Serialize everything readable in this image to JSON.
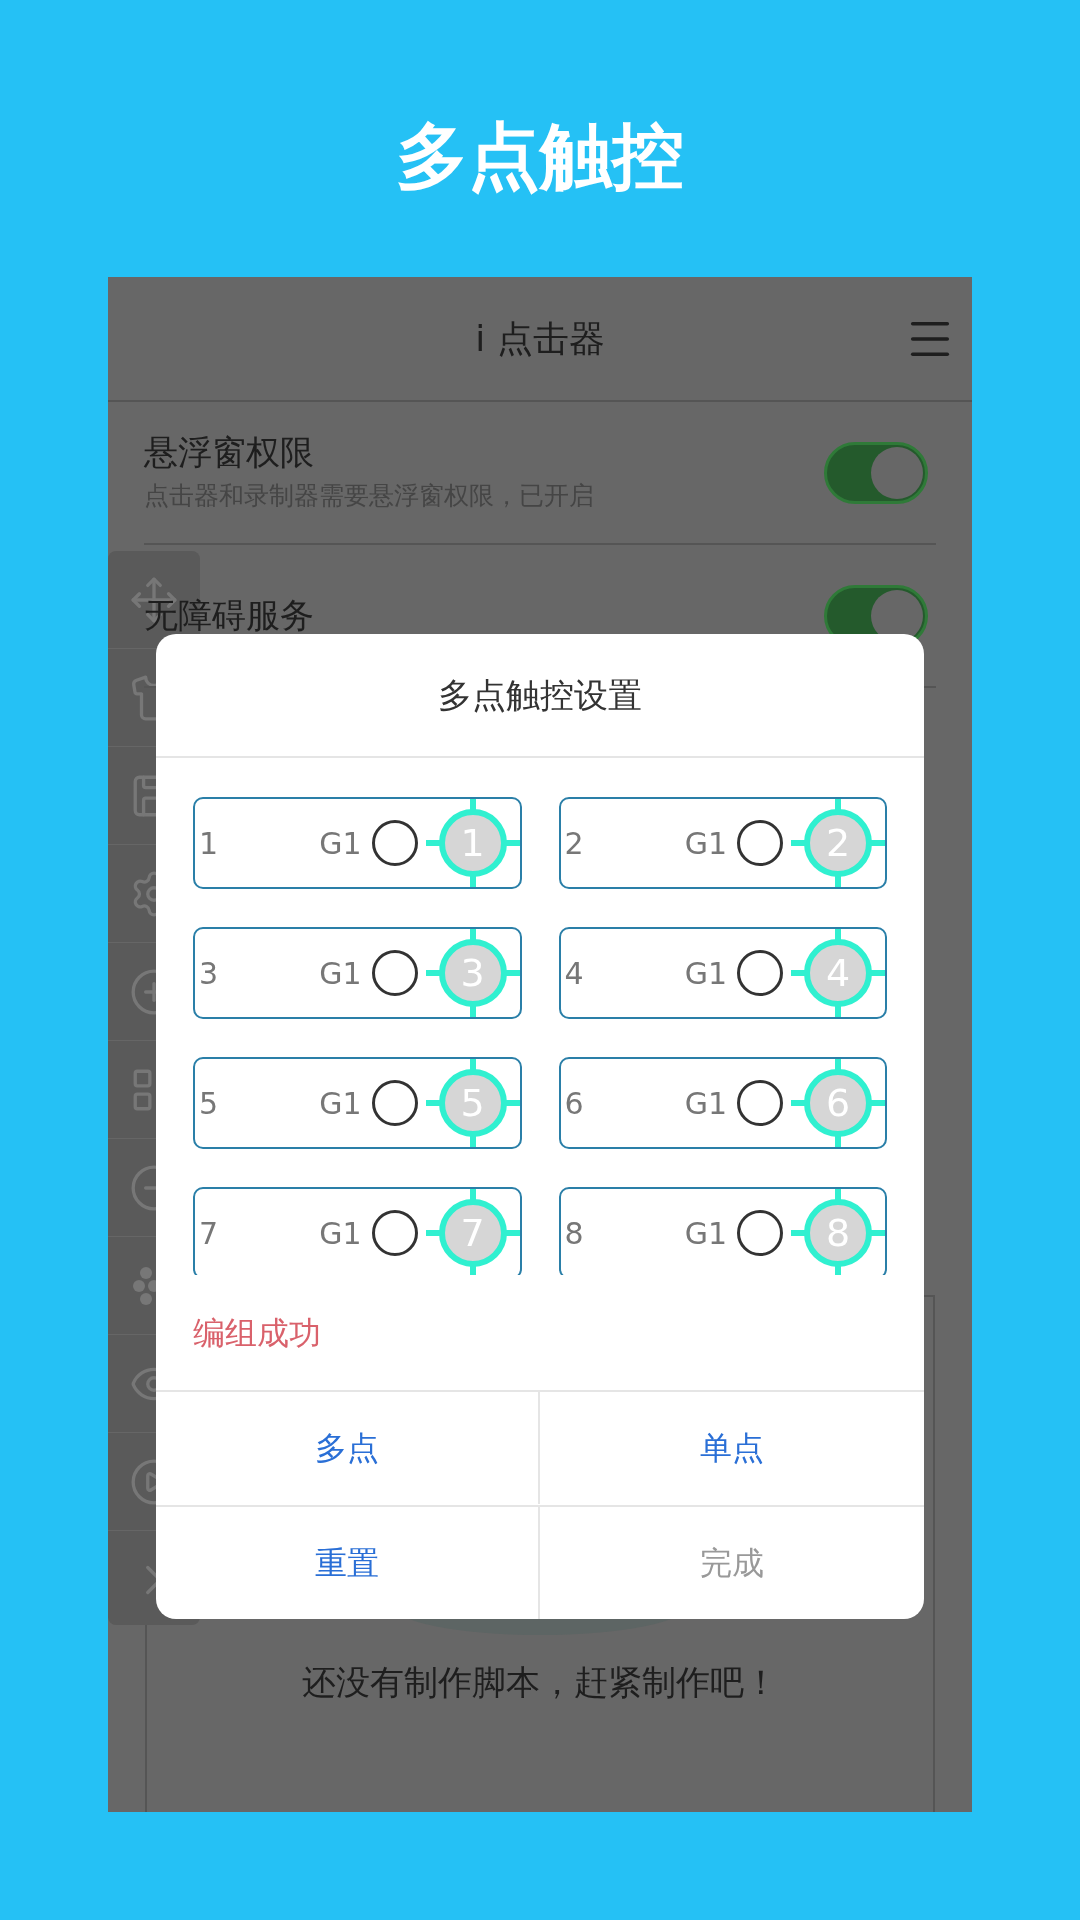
{
  "page_title": "多点触控",
  "app": {
    "title": "i 点击器",
    "settings": [
      {
        "title": "悬浮窗权限",
        "subtitle": "点击器和录制器需要悬浮窗权限，已开启",
        "on": true
      },
      {
        "title": "无障碍服务",
        "on": true
      }
    ],
    "empty_message": "还没有制作脚本，赶紧制作吧！"
  },
  "dialog": {
    "title": "多点触控设置",
    "points": [
      {
        "index": "1",
        "group": "G1",
        "marker": "1",
        "selected": false
      },
      {
        "index": "2",
        "group": "G1",
        "marker": "2",
        "selected": false
      },
      {
        "index": "3",
        "group": "G1",
        "marker": "3",
        "selected": false
      },
      {
        "index": "4",
        "group": "G1",
        "marker": "4",
        "selected": false
      },
      {
        "index": "5",
        "group": "G1",
        "marker": "5",
        "selected": false
      },
      {
        "index": "6",
        "group": "G1",
        "marker": "6",
        "selected": false
      },
      {
        "index": "7",
        "group": "G1",
        "marker": "7",
        "selected": false
      },
      {
        "index": "8",
        "group": "G1",
        "marker": "8",
        "selected": false
      }
    ],
    "status": "编组成功",
    "buttons": [
      {
        "label": "多点",
        "disabled": false
      },
      {
        "label": "单点",
        "disabled": false
      },
      {
        "label": "重置",
        "disabled": false
      },
      {
        "label": "完成",
        "disabled": true
      }
    ]
  }
}
